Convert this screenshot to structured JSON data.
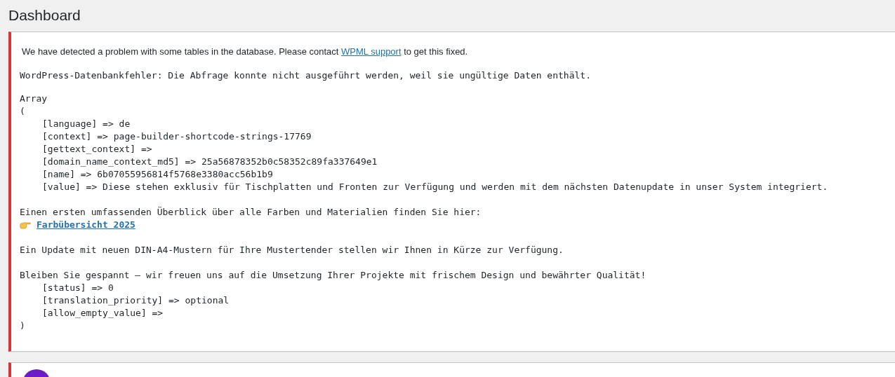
{
  "page_title": "Dashboard",
  "notice": {
    "message_before": "We have detected a problem with some tables in the database. Please contact ",
    "message_link": "WPML support",
    "message_after": " to get this fixed.",
    "error_line": "WordPress-Datenbankfehler: Die Abfrage konnte nicht ausgeführt werden, weil sie ungültige Daten enthält.",
    "dump": [
      {
        "kind": "text",
        "text": "Array"
      },
      {
        "kind": "text",
        "text": "("
      },
      {
        "kind": "entry",
        "text": "[language] => de"
      },
      {
        "kind": "entry",
        "text": "[context] => page-builder-shortcode-strings-17769"
      },
      {
        "kind": "entry",
        "text": "[gettext_context] =>"
      },
      {
        "kind": "entry",
        "text": "[domain_name_context_md5] => 25a56878352b0c58352c89fa337649e1"
      },
      {
        "kind": "entry",
        "text": "[name] => 6b07055956814f5768e3380acc56b1b9"
      },
      {
        "kind": "entry",
        "text": "[value] => Diese stehen exklusiv für Tischplatten und Fronten zur Verfügung und werden mit dem nächsten Datenupdate in unser System integriert."
      },
      {
        "kind": "blank"
      },
      {
        "kind": "text",
        "text": "Einen ersten umfassenden Überblick über alle Farben und Materialien finden Sie hier:"
      },
      {
        "kind": "link",
        "text": "Farbübersicht 2025"
      },
      {
        "kind": "blank"
      },
      {
        "kind": "text",
        "text": "Ein Update mit neuen DIN-A4-Mustern für Ihre Mustertender stellen wir Ihnen in Kürze zur Verfügung."
      },
      {
        "kind": "blank"
      },
      {
        "kind": "text",
        "text": "Bleiben Sie gespannt – wir freuen uns auf die Umsetzung Ihrer Projekte mit frischem Design und bewährter Qualität!"
      },
      {
        "kind": "entry",
        "text": "[status] => 0"
      },
      {
        "kind": "entry",
        "text": "[translation_priority] => optional"
      },
      {
        "kind": "entry",
        "text": "[allow_empty_value] =>"
      },
      {
        "kind": "text",
        "text": ")"
      }
    ]
  }
}
